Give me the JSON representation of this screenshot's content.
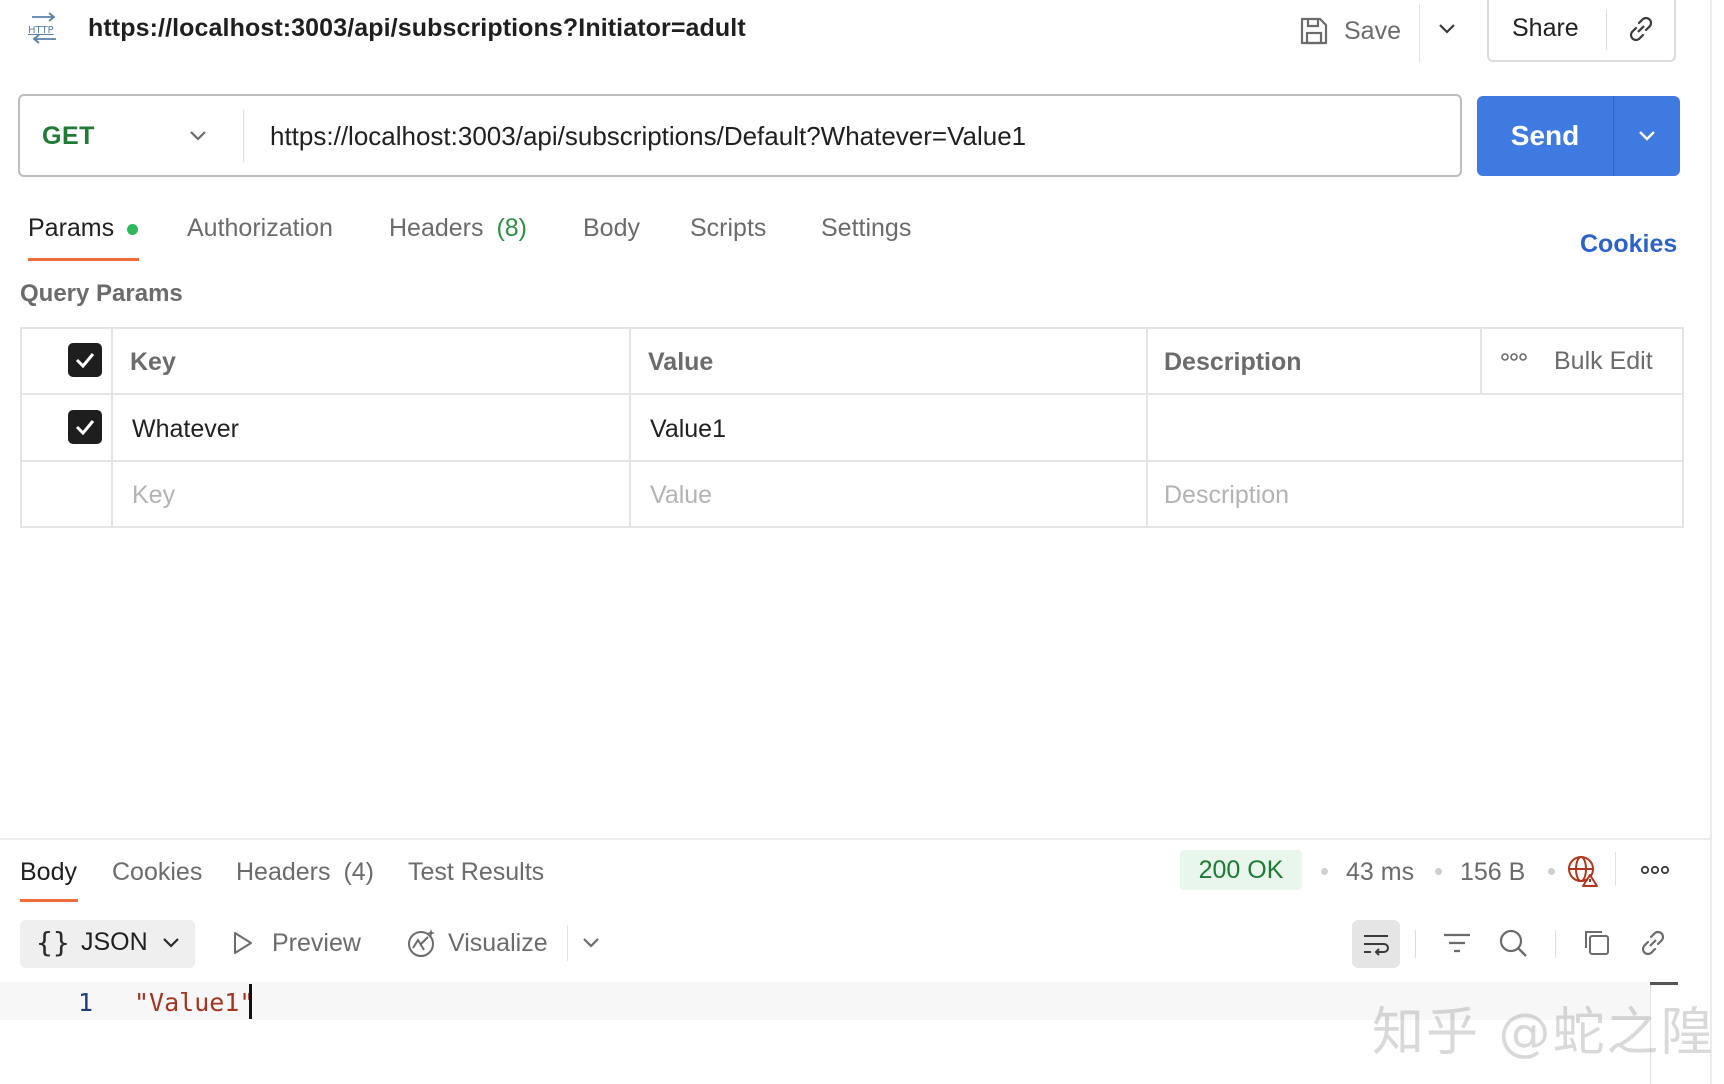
{
  "header": {
    "http_badge": "HTTP",
    "title_url": "https://localhost:3003/api/subscriptions?Initiator=adult",
    "save_label": "Save",
    "share_label": "Share"
  },
  "request": {
    "method": "GET",
    "url": "https://localhost:3003/api/subscriptions/Default?Whatever=Value1",
    "send_label": "Send"
  },
  "request_tabs": [
    {
      "label": "Params"
    },
    {
      "label": "Authorization"
    },
    {
      "label": "Headers"
    },
    {
      "label": "Body"
    },
    {
      "label": "Scripts"
    },
    {
      "label": "Settings"
    }
  ],
  "headers_count": "(8)",
  "cookies_link": "Cookies",
  "query_params": {
    "title": "Query Params",
    "columns": {
      "key": "Key",
      "value": "Value",
      "description": "Description"
    },
    "bulk_edit": "Bulk Edit",
    "rows": [
      {
        "checked": true,
        "key": "Whatever",
        "value": "Value1",
        "description": ""
      }
    ],
    "placeholders": {
      "key": "Key",
      "value": "Value",
      "description": "Description"
    }
  },
  "response": {
    "tabs": [
      {
        "label": "Body"
      },
      {
        "label": "Cookies"
      },
      {
        "label": "Headers"
      },
      {
        "label": "Test Results"
      }
    ],
    "headers_count": "(4)",
    "status": "200 OK",
    "time": "43 ms",
    "size": "156 B",
    "format": "JSON",
    "preview_label": "Preview",
    "visualize_label": "Visualize",
    "code_lines": [
      {
        "number": "1",
        "text": "\"Value1\""
      }
    ]
  },
  "watermark": "知乎 @蛇之隍",
  "colors": {
    "send": "#3f7ae0",
    "method": "#1f7a34",
    "tab_underline": "#f26b3a",
    "status_ok_bg": "#e9f6ec",
    "link": "#2d63c8",
    "json_string": "#a3341f"
  }
}
